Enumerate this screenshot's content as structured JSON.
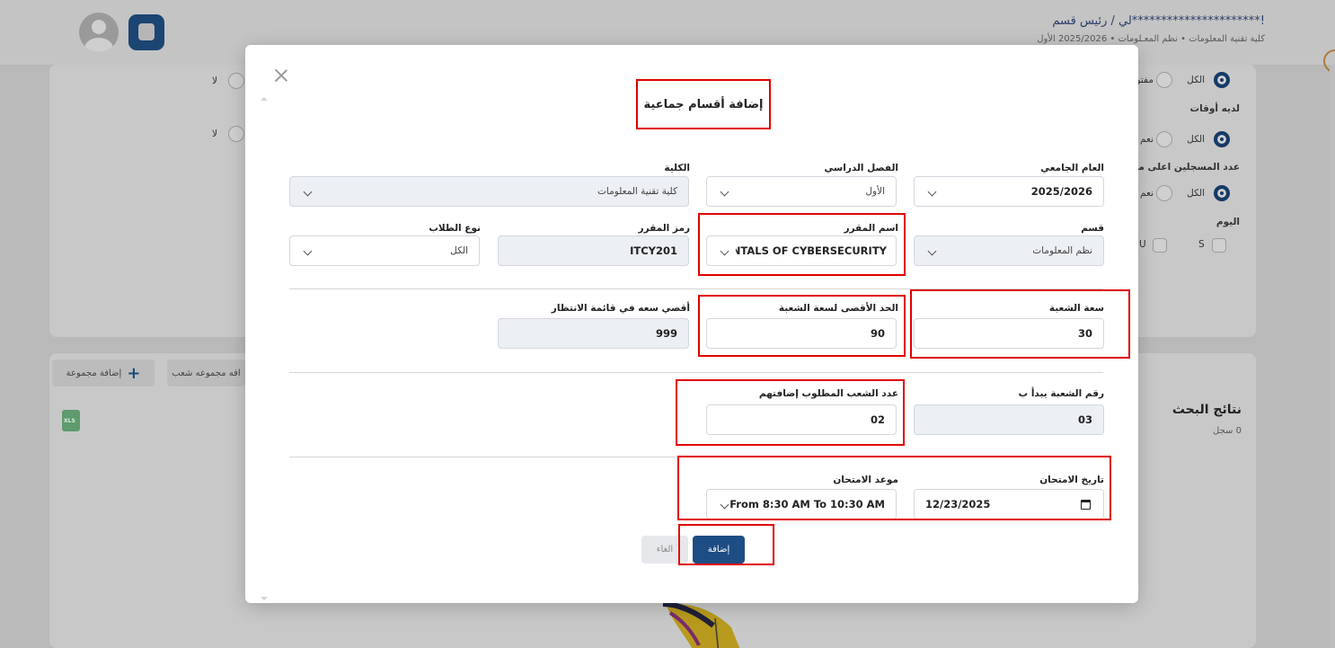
{
  "background": {
    "user_title": "!**********************لي / رئيس قسم",
    "breadcrumb": "كلية تقنية المعلومات  •  نظم المعـلومات  •  2025/2026 الأول",
    "filters": {
      "row1_all": "الكل",
      "row1_open": "مفتو",
      "has_times_label": "لديه أوقات",
      "row2_all": "الكل",
      "row2_yes": "نعم",
      "registered_label": "عدد المسجلين اعلى من",
      "row3_all": "الكل",
      "row3_yes": "نعم",
      "day_label": "اليوم",
      "day_s": "S",
      "day_u": "U",
      "no_1": "لا",
      "no_2": "لا"
    },
    "buttons": {
      "add_group": "إضافة مجموعة",
      "add_section_group": "افه مجموعه شعب"
    },
    "results": {
      "title": "نتائج البحث",
      "count": "0 سجل"
    }
  },
  "modal": {
    "title": "إضافة أقسام جماعية",
    "fields": {
      "academic_year": {
        "label": "العام الجامعي",
        "value": "2025/2026"
      },
      "semester": {
        "label": "الفصل الدراسي",
        "value": "الأول"
      },
      "college": {
        "label": "الكلية",
        "value": "كلية تقنية المعلومات"
      },
      "department": {
        "label": "قسم",
        "value": "نظم المعلومات"
      },
      "course_name": {
        "label": "اسم المقرر",
        "value": "FUNDAMENTALS OF CYBERSECURITY"
      },
      "course_code": {
        "label": "رمز المقرر",
        "value": "ITCY201"
      },
      "student_type": {
        "label": "نوع الطلاب",
        "value": "الكل"
      },
      "section_capacity": {
        "label": "سعة الشعبة",
        "value": "30"
      },
      "max_capacity": {
        "label": "الحد الأقصى لسعة الشعبة",
        "value": "90"
      },
      "waitlist_max": {
        "label": "أقصي سعه في قائمة الانتظار",
        "value": "999"
      },
      "section_start": {
        "label": "رقم الشعبة يبدأ ب",
        "value": "03"
      },
      "sections_count": {
        "label": "عدد الشعب المطلوب إضافتهم",
        "value": "02"
      },
      "exam_date": {
        "label": "تاريخ الامتحان",
        "value": "12/23/2025"
      },
      "exam_time": {
        "label": "موعد الامتحان",
        "value": "From 8:30 AM To 10:30 AM"
      }
    },
    "buttons": {
      "submit": "إضافة",
      "cancel": "الغاء"
    }
  },
  "colors": {
    "primary": "#1d4d84",
    "highlight": "#e00000",
    "disabled_bg": "#eceff3"
  },
  "icons": [
    "close-icon",
    "chevron-down-icon",
    "calendar-icon",
    "plus-icon",
    "excel-icon",
    "chat-icon",
    "avatar"
  ]
}
